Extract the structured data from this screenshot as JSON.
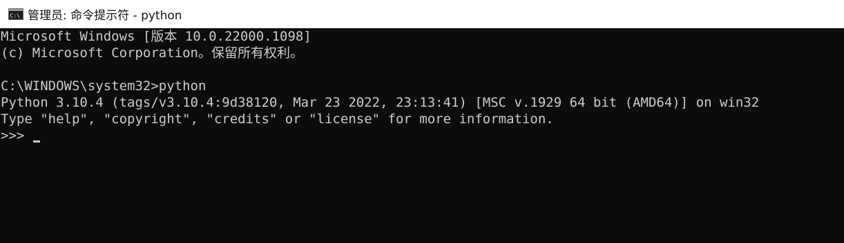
{
  "window": {
    "title": "管理员: 命令提示符 - python",
    "icon": "cmd-icon",
    "icon_text": "C:\\"
  },
  "console": {
    "lines": [
      "Microsoft Windows [版本 10.0.22000.1098]",
      "(c) Microsoft Corporation。保留所有权利。",
      "",
      "C:\\WINDOWS\\system32>python",
      "Python 3.10.4 (tags/v3.10.4:9d38120, Mar 23 2022, 23:13:41) [MSC v.1929 64 bit (AMD64)] on win32",
      "Type \"help\", \"copyright\", \"credits\" or \"license\" for more information.",
      ">>> "
    ]
  },
  "colors": {
    "console_background": "#0c0c0c",
    "console_text": "#cccccc",
    "titlebar_background": "#ffffff"
  }
}
